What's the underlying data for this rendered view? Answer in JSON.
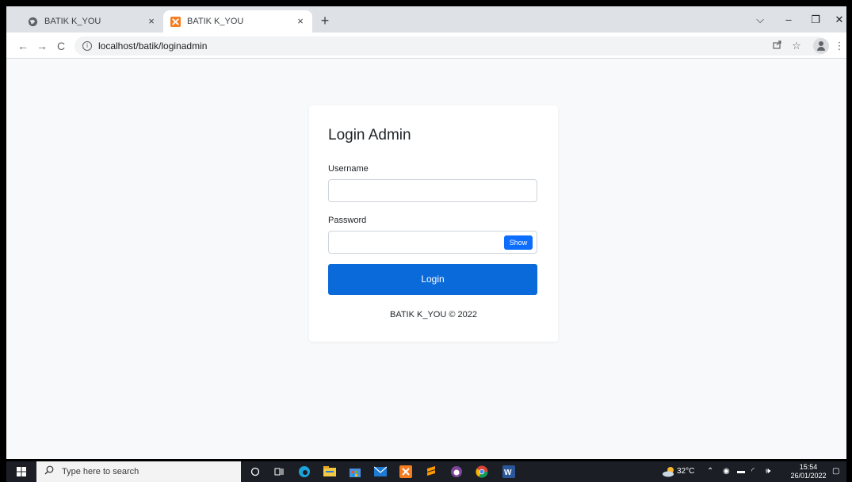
{
  "browser": {
    "tabs": [
      {
        "title": "BATIK K_YOU",
        "active": false
      },
      {
        "title": "BATIK K_YOU",
        "active": true
      }
    ],
    "close_symbol": "×",
    "new_tab_symbol": "+",
    "url": "localhost/batik/loginadmin",
    "window_controls": {
      "dropdown": "⌵",
      "minimize": "–",
      "restore": "❐",
      "close": "✕"
    }
  },
  "login": {
    "title": "Login Admin",
    "username_label": "Username",
    "username_value": "",
    "password_label": "Password",
    "password_value": "",
    "show_label": "Show",
    "submit_label": "Login",
    "footer": "BATIK K_YOU © 2022"
  },
  "taskbar": {
    "search_placeholder": "Type here to search",
    "weather": "32°C",
    "time": "15:54",
    "date": "26/01/2022"
  },
  "colors": {
    "primary": "#0b6ad9",
    "show_button": "#0d6efd",
    "page_bg": "#f8f9fa",
    "taskbar_bg": "#1b1f25"
  }
}
